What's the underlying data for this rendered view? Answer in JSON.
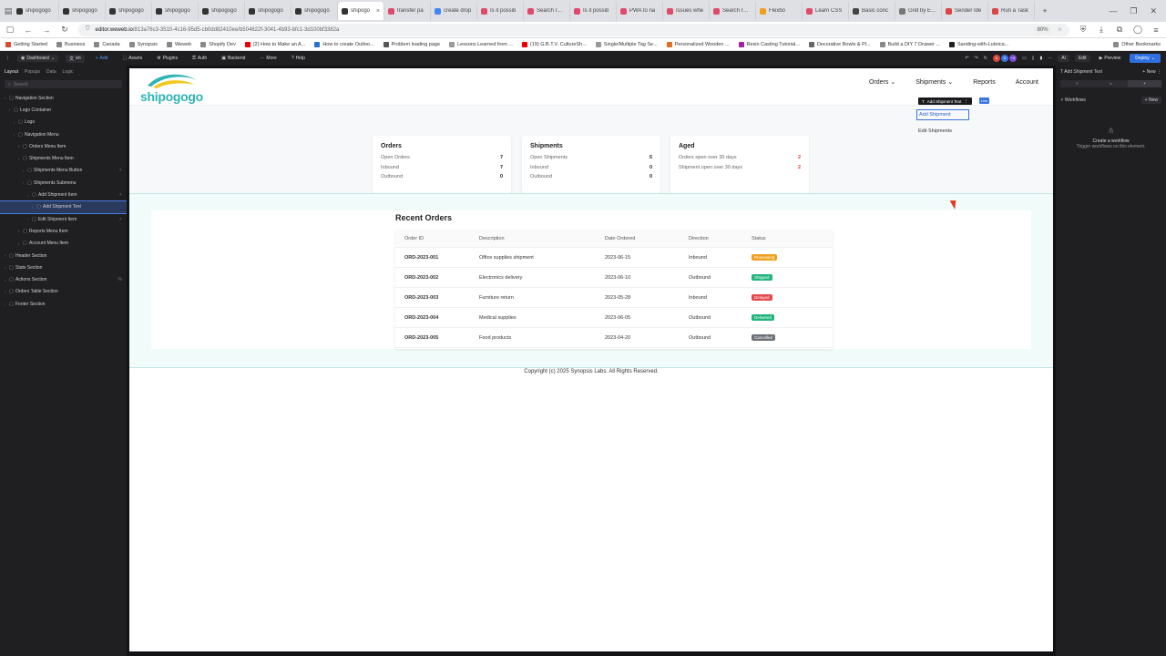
{
  "browser": {
    "tabs": [
      {
        "label": "shipogogo",
        "color": "#333"
      },
      {
        "label": "shipogogo",
        "color": "#333"
      },
      {
        "label": "shipogogo",
        "color": "#333"
      },
      {
        "label": "shipogogo",
        "color": "#333"
      },
      {
        "label": "shipogogo",
        "color": "#333"
      },
      {
        "label": "shipogogo",
        "color": "#333"
      },
      {
        "label": "shipogogo",
        "color": "#333"
      },
      {
        "label": "shipogo",
        "color": "#333",
        "active": true
      },
      {
        "label": "transfer pa",
        "color": "#e04a6a"
      },
      {
        "label": "create drop",
        "color": "#4285f4"
      },
      {
        "label": "Is it possib",
        "color": "#e04a6a"
      },
      {
        "label": "Search resu",
        "color": "#e04a6a"
      },
      {
        "label": "Is it possib",
        "color": "#e04a6a"
      },
      {
        "label": "PWA to na",
        "color": "#e04a6a"
      },
      {
        "label": "Issues whe",
        "color": "#e04a6a"
      },
      {
        "label": "Search resu",
        "color": "#e04a6a"
      },
      {
        "label": "Flexbo",
        "color": "#f0a020"
      },
      {
        "label": "Learn CSS",
        "color": "#e04a6a"
      },
      {
        "label": "Basic conc",
        "color": "#444"
      },
      {
        "label": "Grid by Exam",
        "color": "#777"
      },
      {
        "label": "Sender Ide",
        "color": "#d44"
      },
      {
        "label": "Run a Task",
        "color": "#d44"
      }
    ],
    "tab_close": "×",
    "new_tab": "+",
    "url_host": "editor.weweb.io",
    "url_path": "/813a76c3-3510-4c16-95d5-cb0dd82410ee/b504622f-3041-4b93-bfc1-3d100bf3382a",
    "zoom": "80%",
    "bookmarks": [
      {
        "label": "Getting Started",
        "color": "#e04a2a"
      },
      {
        "label": "Business",
        "color": "#888"
      },
      {
        "label": "Canada",
        "color": "#888"
      },
      {
        "label": "Synopsis",
        "color": "#888"
      },
      {
        "label": "Weweb",
        "color": "#888"
      },
      {
        "label": "Shopify Dev",
        "color": "#888"
      },
      {
        "label": "(2) How to Make an A...",
        "color": "#e00"
      },
      {
        "label": "How to create Outloo...",
        "color": "#2a6fd4"
      },
      {
        "label": "Problem loading page",
        "color": "#555"
      },
      {
        "label": "Lessons Learned from ...",
        "color": "#999"
      },
      {
        "label": "(19) G.B.T.V. CultureSh...",
        "color": "#e00"
      },
      {
        "label": "Single/Multiple Tag Se...",
        "color": "#999"
      },
      {
        "label": "Personalized Wooden ...",
        "color": "#e07020"
      },
      {
        "label": "Resin Casting Tutorial...",
        "color": "#a020a0"
      },
      {
        "label": "Decorative Bowls & Pl...",
        "color": "#666"
      },
      {
        "label": "Build a DIY 7 Drawer ...",
        "color": "#888"
      },
      {
        "label": "Sanding-with-Lubrica...",
        "color": "#222"
      }
    ],
    "other_bookmarks": "Other Bookmarks"
  },
  "editor": {
    "page_selector": "Dashboard",
    "lang": "en",
    "toolbar": [
      {
        "label": "Add",
        "accent": true
      },
      {
        "label": "Assets"
      },
      {
        "label": "Plugins"
      },
      {
        "label": "Auth"
      },
      {
        "label": "Backend"
      },
      {
        "label": "More"
      },
      {
        "label": "Help"
      }
    ],
    "avatars": [
      {
        "label": "S",
        "color": "#d4463b"
      },
      {
        "label": "S",
        "color": "#3b73e0"
      },
      {
        "label": "+3",
        "color": "#7a4ad4"
      }
    ],
    "ai_label": "AI",
    "edit_label": "Edit",
    "preview_label": "Preview",
    "deploy_label": "Deploy",
    "left_tabs": [
      "Layout",
      "Popups",
      "Data",
      "Logic"
    ],
    "search_placeholder": "Search",
    "tree": [
      {
        "label": "Navigation Section",
        "indent": 0
      },
      {
        "label": "Logo Container",
        "indent": 1
      },
      {
        "label": "Logo",
        "indent": 2
      },
      {
        "label": "Navigation Menu",
        "indent": 2
      },
      {
        "label": "Orders Menu Item",
        "indent": 3
      },
      {
        "label": "Shipments Menu Item",
        "indent": 3
      },
      {
        "label": "Shipments Menu Button",
        "indent": 4,
        "ext": "⚡"
      },
      {
        "label": "Shipments Submenu",
        "indent": 4
      },
      {
        "label": "Add Shipment Item",
        "indent": 5,
        "ext": "⚡"
      },
      {
        "label": "Add Shipment Text",
        "indent": 6,
        "sel": true
      },
      {
        "label": "Edit Shipment Item",
        "indent": 5,
        "ext": "⚡"
      },
      {
        "label": "Reports Menu Item",
        "indent": 3
      },
      {
        "label": "Account Menu Item",
        "indent": 3
      },
      {
        "label": "Header Section",
        "indent": 0
      },
      {
        "label": "Stats Section",
        "indent": 0
      },
      {
        "label": "Actions Section",
        "indent": 0,
        "ext": "%"
      },
      {
        "label": "Orders Table Section",
        "indent": 0
      },
      {
        "label": "Footer Section",
        "indent": 0
      }
    ],
    "right_panel": {
      "title": "Add Shipment Text",
      "new_label": "New",
      "tabs": [
        "✎",
        "fx",
        "⚡"
      ],
      "workflows_label": "Workflows",
      "workflows_new": "New",
      "empty_title": "Create a workflow",
      "empty_sub": "Trigger workflows on this element."
    }
  },
  "site": {
    "logo_text": "shipogogo",
    "nav": [
      {
        "label": "Orders",
        "caret": true
      },
      {
        "label": "Shipments",
        "caret": true
      },
      {
        "label": "Reports",
        "caret": false
      },
      {
        "label": "Account",
        "caret": false
      }
    ],
    "submenu": [
      "Add Shipment",
      "Edit Shipments"
    ],
    "selected_element_label": "Add Shipment Text",
    "selected_chip": "Link",
    "stats": [
      {
        "title": "Orders",
        "rows": [
          [
            "Open Orders",
            "7"
          ],
          [
            "Inbound",
            "7"
          ],
          [
            "Outbound",
            "0"
          ]
        ]
      },
      {
        "title": "Shipments",
        "rows": [
          [
            "Open Shipments",
            "5"
          ],
          [
            "Inbound",
            "0"
          ],
          [
            "Outbound",
            "0"
          ]
        ]
      },
      {
        "title": "Aged",
        "rows": [
          [
            "Orders open over 30 days",
            "2"
          ],
          [
            "Shipment open over 30 days",
            "2"
          ]
        ],
        "red": true
      }
    ],
    "orders_title": "Recent Orders",
    "columns": [
      "Order ID",
      "Description",
      "Date Ordered",
      "Direction",
      "Status"
    ],
    "orders": [
      {
        "id": "ORD-2023-001",
        "desc": "Office supplies shipment",
        "date": "2023-06-15",
        "dir": "Inbound",
        "status": "Processing",
        "color": "#f0a020"
      },
      {
        "id": "ORD-2023-002",
        "desc": "Electronics delivery",
        "date": "2023-06-10",
        "dir": "Outbound",
        "status": "Shipped",
        "color": "#1fb57a"
      },
      {
        "id": "ORD-2023-003",
        "desc": "Furniture return",
        "date": "2023-05-28",
        "dir": "Inbound",
        "status": "Delayed",
        "color": "#e5484d"
      },
      {
        "id": "ORD-2023-004",
        "desc": "Medical supplies",
        "date": "2023-06-05",
        "dir": "Outbound",
        "status": "Delivered",
        "color": "#1fb57a"
      },
      {
        "id": "ORD-2023-005",
        "desc": "Food products",
        "date": "2023-04-20",
        "dir": "Outbound",
        "status": "Cancelled",
        "color": "#6b6f76"
      }
    ],
    "footer": "Copyright (c) 2025 Synopsis Labs.  All Rights Reserved."
  }
}
